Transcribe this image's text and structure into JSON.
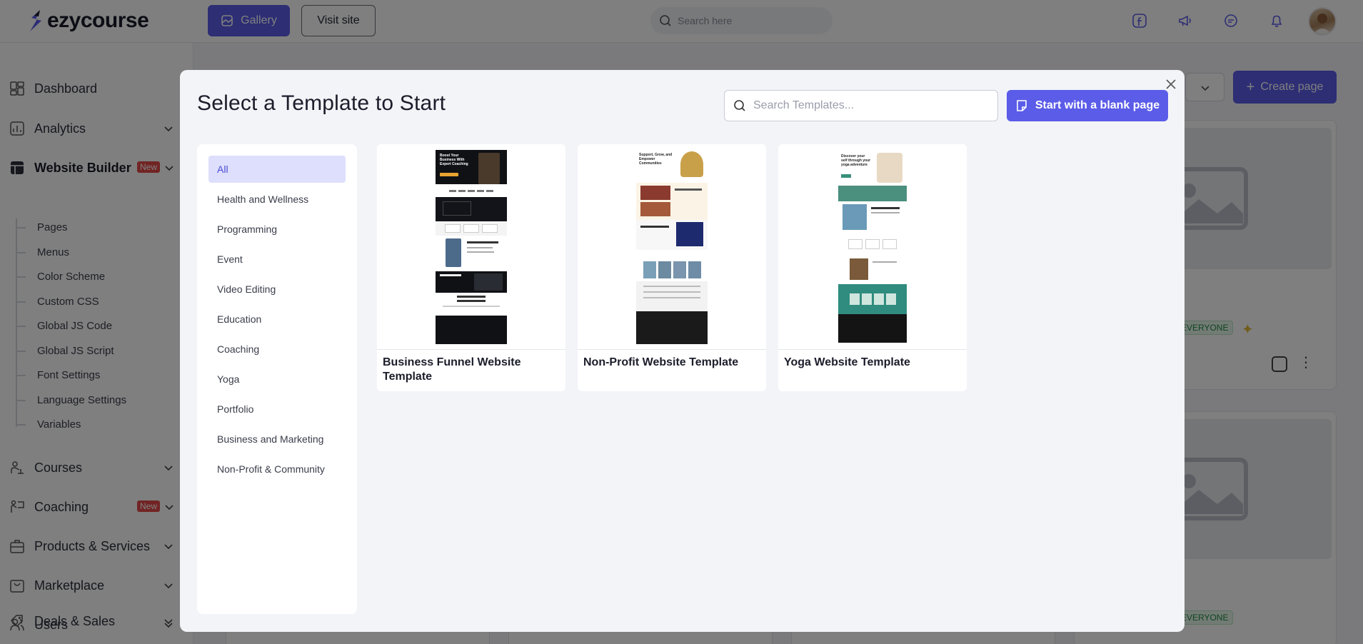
{
  "app": {
    "logo_text": "ezycourse"
  },
  "topbar": {
    "gallery_label": "Gallery",
    "visit_site_label": "Visit site",
    "search_placeholder": "Search here"
  },
  "sidebar": {
    "items": [
      {
        "label": "Dashboard",
        "icon": "dashboard-icon"
      },
      {
        "label": "Analytics",
        "icon": "analytics-icon"
      },
      {
        "label": "Website Builder",
        "icon": "website-builder-icon",
        "badge": "New"
      },
      {
        "label": "Courses",
        "icon": "courses-icon"
      },
      {
        "label": "Coaching",
        "icon": "coaching-icon",
        "badge": "New"
      },
      {
        "label": "Products & Services",
        "icon": "products-icon"
      },
      {
        "label": "Marketplace",
        "icon": "marketplace-icon"
      },
      {
        "label": "Users",
        "icon": "users-icon"
      },
      {
        "label": "Deals & Sales",
        "icon": "deals-icon"
      }
    ],
    "website_builder_sub": [
      "Pages",
      "Menus",
      "Color Scheme",
      "Custom CSS",
      "Global JS Code",
      "Global JS Script",
      "Font Settings",
      "Language Settings",
      "Variables"
    ]
  },
  "background": {
    "create_page_label": "Create page",
    "tag_label": "EVERYONE"
  },
  "modal": {
    "title": "Select a Template to Start",
    "search_placeholder": "Search Templates...",
    "blank_button_label": "Start with a blank page",
    "categories": [
      "All",
      "Health and Wellness",
      "Programming",
      "Event",
      "Video Editing",
      "Education",
      "Coaching",
      "Yoga",
      "Portfolio",
      "Business and Marketing",
      "Non-Profit & Community"
    ],
    "selected_category": "All",
    "templates": [
      {
        "name": "Business Funnel Website Template",
        "preview_hero_text": "Boost Your Business With Expert Coaching"
      },
      {
        "name": "Non-Profit Website Template",
        "preview_hero_text": "Support, Grow, and Empower Communities"
      },
      {
        "name": "Yoga Website Template",
        "preview_hero_text": "Discover your self through your yoga adventure"
      }
    ]
  },
  "colors": {
    "accent": "#5b5ce8",
    "danger": "#e54848",
    "success": "#1c8a3f"
  }
}
